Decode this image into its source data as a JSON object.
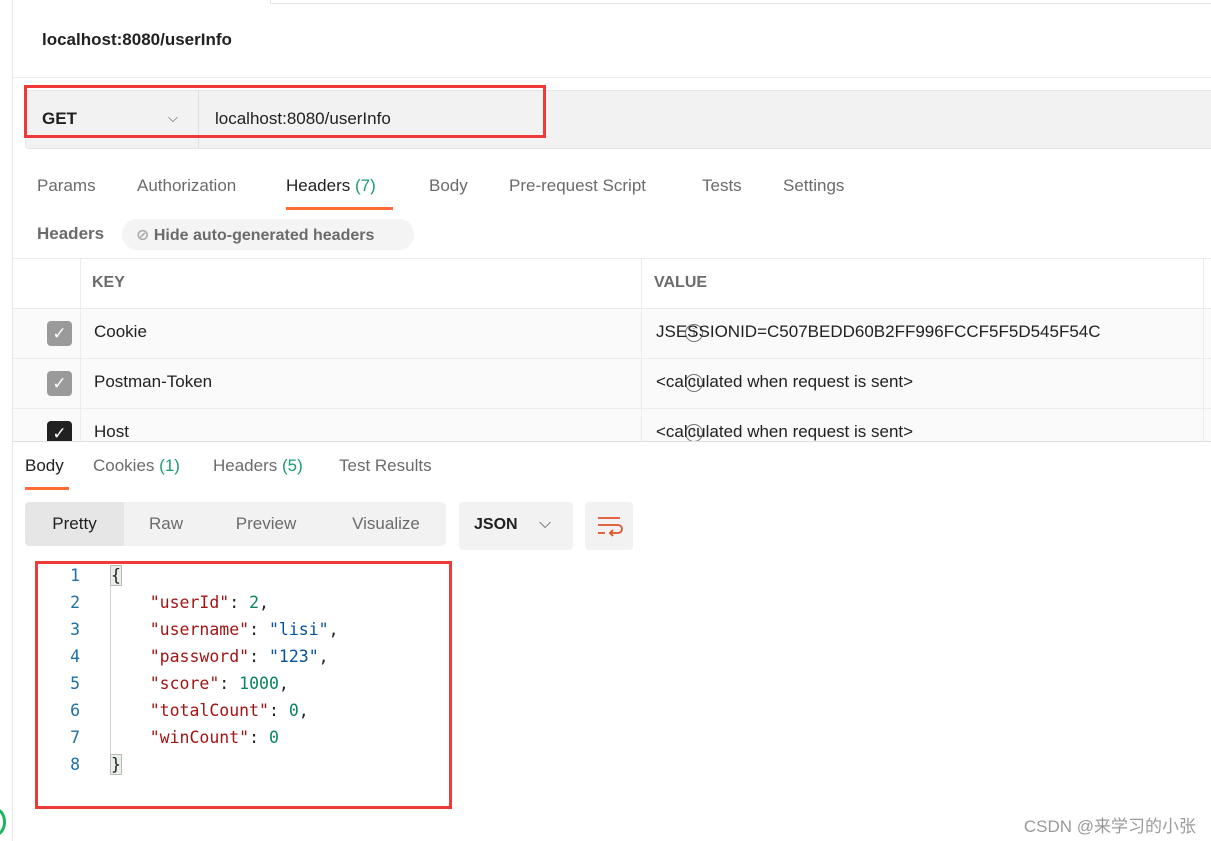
{
  "request": {
    "title": "localhost:8080/userInfo",
    "method": "GET",
    "url": "localhost:8080/userInfo"
  },
  "request_tabs": [
    {
      "label": "Params"
    },
    {
      "label": "Authorization"
    },
    {
      "label": "Headers",
      "count": "(7)"
    },
    {
      "label": "Body"
    },
    {
      "label": "Pre-request Script"
    },
    {
      "label": "Tests"
    },
    {
      "label": "Settings"
    }
  ],
  "headers_section": {
    "label": "Headers",
    "hide_button": "Hide auto-generated headers"
  },
  "headers_table": {
    "columns": [
      "KEY",
      "VALUE"
    ],
    "rows": [
      {
        "checked": true,
        "key": "Cookie",
        "value": "JSESSIONID=C507BEDD60B2FF996FCCF5F5D545F54C"
      },
      {
        "checked": true,
        "key": "Postman-Token",
        "value": "<calculated when request is sent>"
      },
      {
        "checked": true,
        "key": "Host",
        "value": "<calculated when request is sent>"
      }
    ]
  },
  "response_tabs": [
    {
      "label": "Body"
    },
    {
      "label": "Cookies",
      "count": "(1)"
    },
    {
      "label": "Headers",
      "count": "(5)"
    },
    {
      "label": "Test Results"
    }
  ],
  "view_modes": [
    "Pretty",
    "Raw",
    "Preview",
    "Visualize"
  ],
  "format": "JSON",
  "body_lines": [
    "1",
    "2",
    "3",
    "4",
    "5",
    "6",
    "7",
    "8"
  ],
  "json": {
    "open": "{",
    "close": "}",
    "fields": [
      {
        "key": "\"userId\"",
        "value": "2",
        "comma": ",",
        "type": "n"
      },
      {
        "key": "\"username\"",
        "value": "\"lisi\"",
        "comma": ",",
        "type": "s"
      },
      {
        "key": "\"password\"",
        "value": "\"123\"",
        "comma": ",",
        "type": "s"
      },
      {
        "key": "\"score\"",
        "value": "1000",
        "comma": ",",
        "type": "n"
      },
      {
        "key": "\"totalCount\"",
        "value": "0",
        "comma": ",",
        "type": "n"
      },
      {
        "key": "\"winCount\"",
        "value": "0",
        "comma": "",
        "type": "n"
      }
    ]
  },
  "watermark": "CSDN @来学习的小张",
  "colors": {
    "accent": "#ff6c37",
    "count": "#1a9e6b",
    "highlight_box": "#f03a3a"
  }
}
